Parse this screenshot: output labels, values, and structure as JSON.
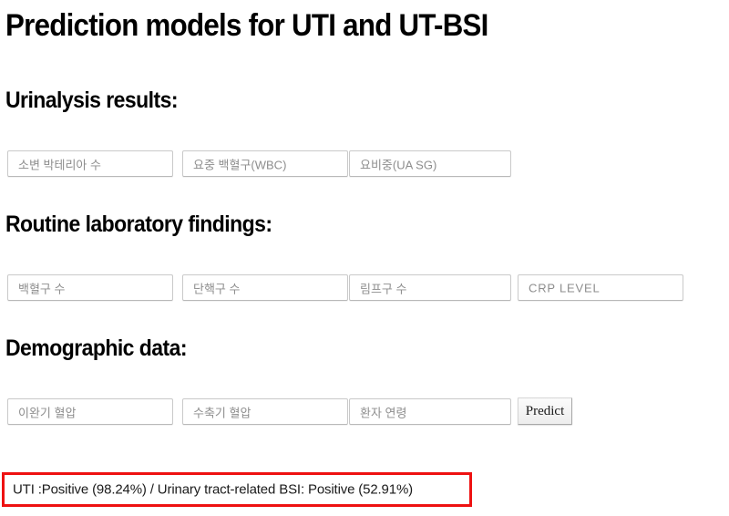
{
  "page": {
    "title": "Prediction models for UTI and UT-BSI"
  },
  "sections": [
    {
      "heading": "Urinalysis results:",
      "fields": [
        {
          "placeholder": "소변 박테리아 수",
          "name": "urine-bacteria-count-input",
          "script": "korean"
        },
        {
          "placeholder": "요중 백혈구(WBC)",
          "name": "urine-wbc-input",
          "script": "korean"
        },
        {
          "placeholder": "요비중(UA SG)",
          "name": "urine-specific-gravity-input",
          "script": "korean"
        }
      ]
    },
    {
      "heading": "Routine laboratory findings:",
      "fields": [
        {
          "placeholder": "백혈구 수",
          "name": "wbc-count-input",
          "script": "korean"
        },
        {
          "placeholder": "단핵구 수",
          "name": "monocyte-count-input",
          "script": "korean"
        },
        {
          "placeholder": "림프구 수",
          "name": "lymphocyte-count-input",
          "script": "korean"
        },
        {
          "placeholder": "CRP LEVEL",
          "name": "crp-level-input",
          "script": "latin"
        }
      ]
    },
    {
      "heading": "Demographic data:",
      "fields": [
        {
          "placeholder": "이완기 혈압",
          "name": "diastolic-bp-input",
          "script": "korean"
        },
        {
          "placeholder": "수축기 혈압",
          "name": "systolic-bp-input",
          "script": "korean"
        },
        {
          "placeholder": "환자 연령",
          "name": "patient-age-input",
          "script": "korean"
        }
      ]
    }
  ],
  "actions": {
    "predict_label": "Predict"
  },
  "result": {
    "text": "UTI :Positive (98.24%) / Urinary tract-related BSI: Positive (52.91%)",
    "uti_label": "Positive",
    "uti_probability": "98.24%",
    "bsi_label": "Positive",
    "bsi_probability": "52.91%",
    "highlight_color": "#ee1111"
  }
}
